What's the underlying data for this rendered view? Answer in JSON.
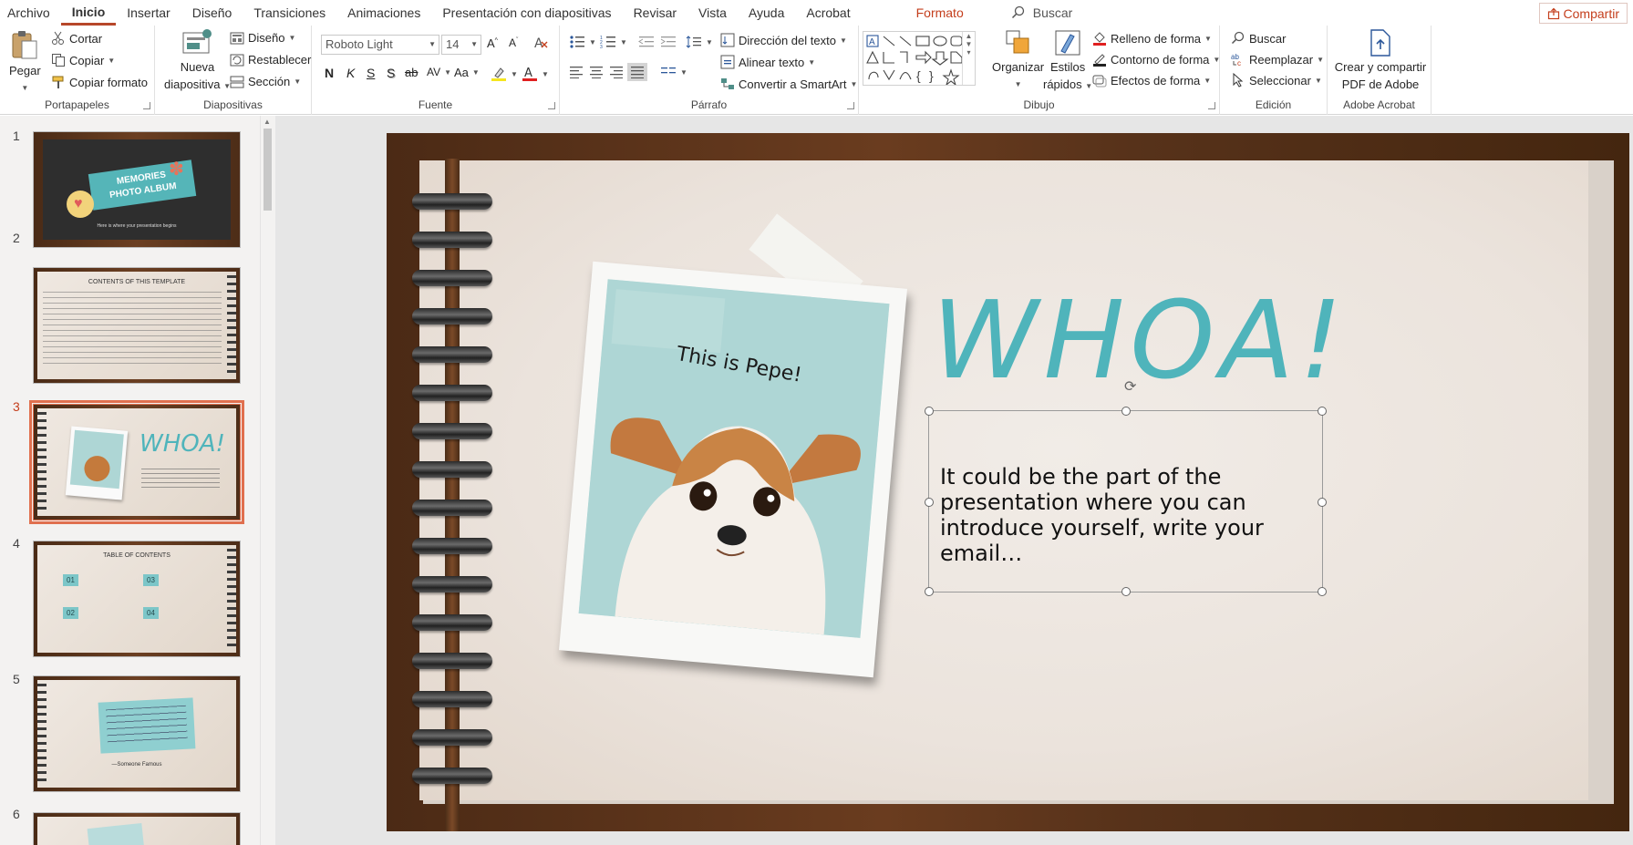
{
  "tabs": [
    "Archivo",
    "Inicio",
    "Insertar",
    "Diseño",
    "Transiciones",
    "Animaciones",
    "Presentación con diapositivas",
    "Revisar",
    "Vista",
    "Ayuda",
    "Acrobat"
  ],
  "format_tab": "Formato",
  "search_label": "Buscar",
  "share_label": "Compartir",
  "ribbon": {
    "clipboard": {
      "paste": "Pegar",
      "cut": "Cortar",
      "copy": "Copiar",
      "copy_format": "Copiar formato",
      "label": "Portapapeles"
    },
    "slides": {
      "new_slide": "Nueva",
      "new_slide2": "diapositiva",
      "layout": "Diseño",
      "reset": "Restablecer",
      "section": "Sección",
      "label": "Diapositivas"
    },
    "font": {
      "font_name": "Roboto Light",
      "font_size": "14",
      "bold": "N",
      "italic": "K",
      "underline": "S",
      "shadow": "S",
      "strike": "ab",
      "label": "Fuente"
    },
    "paragraph": {
      "text_direction": "Dirección del texto",
      "align_text": "Alinear texto",
      "smartart": "Convertir a SmartArt",
      "label": "Párrafo"
    },
    "drawing": {
      "arrange": "Organizar",
      "quick_styles": "Estilos",
      "quick_styles2": "rápidos",
      "shape_fill": "Relleno de forma",
      "shape_outline": "Contorno de forma",
      "shape_effects": "Efectos de forma",
      "label": "Dibujo"
    },
    "editing": {
      "find": "Buscar",
      "replace": "Reemplazar",
      "select": "Seleccionar",
      "label": "Edición"
    },
    "acrobat": {
      "create": "Crear y compartir",
      "create2": "PDF de Adobe",
      "label": "Adobe Acrobat"
    }
  },
  "thumbs": {
    "numbers": [
      "1",
      "2",
      "3",
      "4",
      "5",
      "6"
    ],
    "t1_title": "MEMORIES",
    "t1_title2": "PHOTO ALBUM",
    "t1_sub": "Here is where your presentation begins",
    "t2_title": "CONTENTS OF THIS TEMPLATE",
    "t3_whoa": "WHOA!",
    "t4_title": "TABLE OF CONTENTS",
    "t4_items": [
      "01",
      "02",
      "03",
      "04"
    ],
    "t5_author": "—Someone Famous"
  },
  "slide": {
    "caption": "This is Pepe!",
    "heading": "WHOA!",
    "body": "It could be the part of the presentation where you can introduce yourself, write your email…"
  },
  "colors": {
    "accent": "#c43e1c",
    "teal": "#4fb4bb",
    "photo_bg": "#aed6d5"
  }
}
